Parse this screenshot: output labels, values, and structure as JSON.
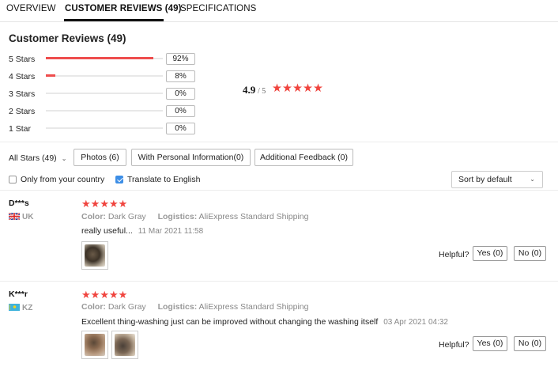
{
  "tabs": [
    {
      "label": "OVERVIEW"
    },
    {
      "label": "CUSTOMER REVIEWS (49)"
    },
    {
      "label": "SPECIFICATIONS"
    }
  ],
  "summary": {
    "title": "Customer Reviews (49)",
    "average": "4.9",
    "out_of": "/ 5",
    "average_stars": 5,
    "star_rows": [
      {
        "label": "5 Stars",
        "percent": "92%",
        "fraction": 0.92
      },
      {
        "label": "4 Stars",
        "percent": "8%",
        "fraction": 0.08
      },
      {
        "label": "3 Stars",
        "percent": "0%",
        "fraction": 0
      },
      {
        "label": "2 Stars",
        "percent": "0%",
        "fraction": 0
      },
      {
        "label": "1 Star",
        "percent": "0%",
        "fraction": 0
      }
    ]
  },
  "filters": {
    "all_stars": "All Stars (49)",
    "buttons": [
      "Photos (6)",
      "With Personal Information(0)",
      "Additional Feedback (0)"
    ],
    "only_country": {
      "label": "Only from your country",
      "checked": false
    },
    "translate": {
      "label": "Translate to English",
      "checked": true
    },
    "sort": "Sort by default"
  },
  "reviews": [
    {
      "user": "D***s",
      "country": "UK",
      "stars": 5,
      "color_label": "Color:",
      "color_value": "Dark Gray",
      "logistics_label": "Logistics:",
      "logistics_value": "AliExpress Standard Shipping",
      "text": "really useful...",
      "date": "11 Mar 2021 11:58",
      "photos": 1,
      "helpful_label": "Helpful?",
      "yes": "Yes (0)",
      "no": "No (0)"
    },
    {
      "user": "K***r",
      "country": "KZ",
      "stars": 5,
      "color_label": "Color:",
      "color_value": "Dark Gray",
      "logistics_label": "Logistics:",
      "logistics_value": "AliExpress Standard Shipping",
      "text": "Excellent thing-washing just can be improved without changing the washing itself",
      "date": "03 Apr 2021 04:32",
      "photos": 2,
      "helpful_label": "Helpful?",
      "yes": "Yes (0)",
      "no": "No (0)"
    }
  ],
  "colors": {
    "accent_star": "#f0443e",
    "bar_fill": "#ee4d4d",
    "checkbox_on": "#3d8ee6"
  }
}
